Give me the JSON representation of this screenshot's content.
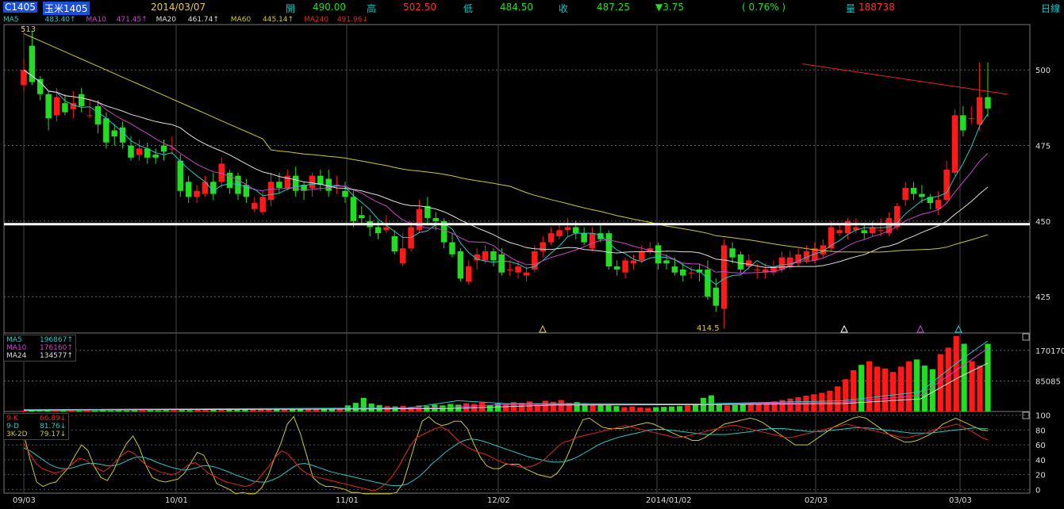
{
  "header": {
    "symbol": "C1405",
    "name": "玉米1405",
    "date": "2014/03/07",
    "open_label": "開",
    "open": "490.00",
    "high_label": "高",
    "high": "502.50",
    "low_label": "低",
    "low": "484.50",
    "close_label": "收",
    "close": "487.25",
    "change": "▼3.75",
    "change_pct": "( 0.76% )",
    "volume_label": "量",
    "volume": "188738",
    "period": "日線"
  },
  "price_legend": {
    "ma5_label": "MA5",
    "ma5": "483.40↑",
    "ma10_label": "MA10",
    "ma10": "471.45↑",
    "ma20_label": "MA20",
    "ma20": "461.74↑",
    "ma60_label": "MA60",
    "ma60": "445.14↑",
    "ma240_label": "MA240",
    "ma240": "491.96↓"
  },
  "volume_legend": {
    "ma5_label": "MA5",
    "ma5": "196867↑",
    "ma10_label": "MA10",
    "ma10": "176160↑",
    "ma24_label": "MA24",
    "ma24": "134577↑"
  },
  "kd_legend": {
    "k_label": "9-K",
    "k": "66.89↓",
    "d_label": "9-D",
    "d": "81.76↓",
    "j_label": "3K-2D",
    "j": "79.17↓"
  },
  "annotations": {
    "high_mark": "513",
    "low_mark": "414.5"
  },
  "colors": {
    "up": "#ff1a1a",
    "down": "#22dd22",
    "ma5": "#22c8c8",
    "ma10": "#cc44cc",
    "ma20": "#dddddd",
    "ma60": "#cccc22",
    "ma240": "#ee2222",
    "grid": "#444444",
    "ref_line": "#ffffff"
  },
  "chart_data": {
    "type": "candlestick",
    "x_tick_labels": [
      "09/03",
      "10/01",
      "11/01",
      "12/02",
      "2014/01/02",
      "02/03",
      "03/03"
    ],
    "price_axis": {
      "ticks": [
        425,
        450,
        475,
        500
      ],
      "range": [
        413,
        515
      ]
    },
    "volume_axis": {
      "ticks": [
        85085,
        170170
      ],
      "range": [
        0,
        210000
      ]
    },
    "kd_axis": {
      "ticks": [
        0,
        20,
        40,
        60,
        80,
        100
      ],
      "range": [
        -5,
        105
      ]
    },
    "reference_price": 449,
    "candles": [
      [
        495,
        500,
        504,
        493
      ],
      [
        508,
        496,
        513,
        495
      ],
      [
        497,
        492,
        498,
        490
      ],
      [
        492,
        484,
        493,
        480
      ],
      [
        485,
        491,
        494,
        483
      ],
      [
        489,
        486,
        492,
        485
      ],
      [
        487,
        489,
        493,
        484
      ],
      [
        492,
        488,
        494,
        486
      ],
      [
        485,
        485,
        490,
        484
      ],
      [
        488,
        482,
        490,
        479
      ],
      [
        484,
        476,
        486,
        474
      ],
      [
        480,
        478,
        482,
        475
      ],
      [
        481,
        476,
        483,
        474
      ],
      [
        475,
        471,
        478,
        470
      ],
      [
        472,
        474,
        477,
        470
      ],
      [
        474,
        471,
        476,
        469
      ],
      [
        472,
        471,
        474,
        469
      ],
      [
        475,
        473,
        477,
        470
      ],
      [
        474,
        474,
        478,
        472
      ],
      [
        470,
        460,
        472,
        458
      ],
      [
        463,
        458,
        465,
        456
      ],
      [
        458,
        460,
        462,
        456
      ],
      [
        459,
        463,
        465,
        458
      ],
      [
        463,
        459,
        466,
        457
      ],
      [
        463,
        469,
        471,
        461
      ],
      [
        466,
        461,
        467,
        459
      ],
      [
        465,
        459,
        466,
        457
      ],
      [
        462,
        458,
        464,
        456
      ],
      [
        454,
        456,
        458,
        453
      ],
      [
        453,
        458,
        460,
        452
      ],
      [
        457,
        463,
        466,
        455
      ],
      [
        463,
        461,
        466,
        459
      ],
      [
        461,
        465,
        467,
        460
      ],
      [
        465,
        460,
        468,
        458
      ],
      [
        462,
        460,
        463,
        457
      ],
      [
        461,
        465,
        466,
        458
      ],
      [
        465,
        462,
        467,
        460
      ],
      [
        464,
        460,
        467,
        458
      ],
      [
        462,
        462,
        465,
        459
      ],
      [
        460,
        458,
        463,
        456
      ],
      [
        458,
        450,
        460,
        448
      ],
      [
        452,
        451,
        455,
        449
      ],
      [
        450,
        448,
        452,
        445
      ],
      [
        448,
        446,
        450,
        444
      ],
      [
        447,
        448,
        452,
        446
      ],
      [
        445,
        440,
        447,
        439
      ],
      [
        436,
        441,
        446,
        435
      ],
      [
        441,
        448,
        450,
        440
      ],
      [
        447,
        454,
        457,
        446
      ],
      [
        455,
        451,
        458,
        449
      ],
      [
        451,
        450,
        453,
        447
      ],
      [
        450,
        443,
        451,
        441
      ],
      [
        443,
        439,
        446,
        438
      ],
      [
        440,
        431,
        441,
        430
      ],
      [
        430,
        435,
        437,
        429
      ],
      [
        437,
        439,
        441,
        434
      ],
      [
        437,
        440,
        442,
        436
      ],
      [
        440,
        437,
        441,
        435
      ],
      [
        439,
        433,
        441,
        432
      ],
      [
        434,
        434,
        437,
        432
      ],
      [
        433,
        435,
        437,
        431
      ],
      [
        432,
        433,
        435,
        430
      ],
      [
        434,
        440,
        442,
        433
      ],
      [
        440,
        443,
        445,
        438
      ],
      [
        443,
        446,
        448,
        442
      ],
      [
        445,
        447,
        449,
        444
      ],
      [
        447,
        448,
        451,
        445
      ],
      [
        448,
        446,
        450,
        444
      ],
      [
        446,
        443,
        448,
        442
      ],
      [
        441,
        446,
        448,
        440
      ],
      [
        446,
        444,
        449,
        443
      ],
      [
        446,
        435,
        447,
        434
      ],
      [
        435,
        434,
        437,
        432
      ],
      [
        433,
        437,
        438,
        431
      ],
      [
        436,
        437,
        439,
        434
      ],
      [
        437,
        440,
        442,
        436
      ],
      [
        440,
        441,
        443,
        439
      ],
      [
        442,
        436,
        443,
        434
      ],
      [
        437,
        436,
        439,
        434
      ],
      [
        435,
        433,
        438,
        432
      ],
      [
        434,
        432,
        436,
        430
      ],
      [
        433,
        433,
        435,
        431
      ],
      [
        434,
        433,
        436,
        430
      ],
      [
        434,
        425,
        437,
        424
      ],
      [
        428,
        422,
        431,
        420
      ],
      [
        421,
        442,
        444,
        414.5
      ],
      [
        441,
        438,
        443,
        436
      ],
      [
        439,
        434,
        440,
        433
      ],
      [
        435,
        437,
        439,
        434
      ],
      [
        434,
        434,
        436,
        431
      ],
      [
        433,
        434,
        436,
        431
      ],
      [
        433,
        435,
        437,
        432
      ],
      [
        434,
        438,
        440,
        433
      ],
      [
        435,
        438,
        440,
        434
      ],
      [
        436,
        439,
        441,
        435
      ],
      [
        437,
        440,
        442,
        436
      ],
      [
        437,
        441,
        443,
        436
      ],
      [
        439,
        442,
        444,
        438
      ],
      [
        441,
        448,
        450,
        440
      ],
      [
        446,
        447,
        449,
        445
      ],
      [
        446,
        450,
        451,
        444
      ],
      [
        447,
        448,
        451,
        446
      ],
      [
        447,
        446,
        449,
        444
      ],
      [
        446,
        448,
        450,
        445
      ],
      [
        447,
        447,
        451,
        445
      ],
      [
        446,
        451,
        453,
        445
      ],
      [
        448,
        455,
        456,
        447
      ],
      [
        457,
        461,
        463,
        455
      ],
      [
        461,
        459,
        463,
        457
      ],
      [
        459,
        458,
        462,
        456
      ],
      [
        458,
        456,
        459,
        454
      ],
      [
        454,
        457,
        460,
        452
      ],
      [
        457,
        467,
        470,
        456
      ],
      [
        466,
        485,
        487,
        465
      ],
      [
        485,
        480,
        488,
        478
      ],
      [
        484,
        484,
        488,
        482
      ],
      [
        482,
        491,
        502.5,
        480
      ],
      [
        491,
        487.25,
        502.5,
        484.5
      ]
    ],
    "price_ma240_endpoints": [
      [
        0.75,
        502
      ],
      [
        0.93,
        491.96
      ]
    ],
    "volume_dates_note": "approximate",
    "volume": [
      2100,
      2300,
      1900,
      2500,
      2000,
      2200,
      2400,
      2100,
      2600,
      2300,
      2800,
      2500,
      3000,
      2700,
      3200,
      2900,
      3400,
      3100,
      3600,
      3300,
      4000,
      3700,
      4500,
      4200,
      5000,
      4700,
      5500,
      5200,
      6000,
      5700,
      6500,
      6200,
      7000,
      6700,
      7500,
      7200,
      8000,
      7700,
      8500,
      8200,
      9000,
      17000,
      24000,
      38000,
      22000,
      18000,
      15000,
      14000,
      16000,
      13000,
      17000,
      15000,
      19000,
      17000,
      21000,
      19000,
      23000,
      21000,
      25000,
      18000,
      22000,
      20000,
      26000,
      24000,
      28000,
      22000,
      30000,
      27000,
      32000,
      24000,
      26000,
      23000,
      21000,
      19000,
      17000,
      15000,
      12000,
      14000,
      11000,
      10000,
      12000,
      13000,
      14000,
      15000,
      17000,
      22000,
      38000,
      45000,
      20000,
      17000,
      18000,
      19000,
      21000,
      23000,
      25000,
      28000,
      32000,
      36000,
      40000,
      44000,
      48000,
      52000,
      58000,
      70000,
      90000,
      115000,
      130000,
      140000,
      125000,
      120000,
      110000,
      125000,
      140000,
      145000,
      128000,
      118000,
      160000,
      178000,
      210000,
      188738,
      140000,
      128000,
      188738
    ],
    "volume_ma_series": [
      {
        "name": "MA5",
        "color": "#22c8c8",
        "points": [
          [
            0,
            5000
          ],
          [
            0.4,
            10000
          ],
          [
            0.45,
            30000
          ],
          [
            0.5,
            22000
          ],
          [
            0.7,
            21000
          ],
          [
            0.85,
            30000
          ],
          [
            0.93,
            55000
          ],
          [
            0.97,
            140000
          ],
          [
            1,
            196867
          ]
        ]
      },
      {
        "name": "MA10",
        "color": "#cc44cc",
        "points": [
          [
            0,
            4000
          ],
          [
            0.42,
            9000
          ],
          [
            0.5,
            20000
          ],
          [
            0.7,
            20000
          ],
          [
            0.85,
            26000
          ],
          [
            0.93,
            45000
          ],
          [
            0.97,
            120000
          ],
          [
            1,
            176160
          ]
        ]
      },
      {
        "name": "MA24",
        "color": "#dddddd",
        "points": [
          [
            0,
            3500
          ],
          [
            0.44,
            8000
          ],
          [
            0.55,
            18000
          ],
          [
            0.7,
            19000
          ],
          [
            0.85,
            22000
          ],
          [
            0.93,
            35000
          ],
          [
            0.97,
            95000
          ],
          [
            1,
            134577
          ]
        ]
      }
    ],
    "kd": {
      "k": [
        62,
        48,
        35,
        28,
        25,
        22,
        24,
        28,
        35,
        42,
        40,
        34,
        28,
        24,
        30,
        38,
        46,
        52,
        48,
        40,
        32,
        28,
        24,
        22,
        20,
        22,
        28,
        34,
        36,
        30,
        22,
        18,
        14,
        10,
        8,
        6,
        4,
        6,
        12,
        22,
        32,
        44,
        52,
        48,
        38,
        28,
        22,
        18,
        16,
        14,
        12,
        10,
        8,
        6,
        4,
        2,
        0,
        -2,
        2,
        8,
        18,
        30,
        45,
        60,
        70,
        74,
        78,
        82,
        84,
        80,
        72,
        64,
        58,
        54,
        50,
        48,
        44,
        40,
        36,
        34,
        32,
        30,
        30,
        32,
        36,
        42,
        50,
        58,
        64,
        66,
        70,
        72,
        74,
        76,
        78,
        80,
        82,
        84,
        86,
        84,
        82,
        80,
        78,
        76,
        74,
        72,
        70,
        70,
        72,
        74,
        76,
        78,
        80,
        82,
        84,
        86,
        86,
        84,
        82,
        80,
        78,
        76,
        74,
        72,
        70,
        70,
        72,
        74,
        76,
        78,
        80,
        82,
        84,
        86,
        88,
        86,
        84,
        82,
        80,
        78,
        76,
        74,
        72,
        70,
        70,
        72,
        74,
        76,
        80,
        82,
        84,
        86,
        88,
        84,
        80,
        75,
        70,
        66.89
      ],
      "d": [
        56,
        52,
        46,
        40,
        34,
        30,
        28,
        28,
        30,
        33,
        35,
        35,
        34,
        32,
        32,
        34,
        38,
        42,
        44,
        43,
        40,
        36,
        33,
        30,
        28,
        26,
        27,
        29,
        32,
        32,
        30,
        27,
        24,
        20,
        17,
        14,
        11,
        10,
        10,
        13,
        17,
        23,
        29,
        34,
        35,
        33,
        30,
        27,
        24,
        22,
        20,
        18,
        16,
        14,
        12,
        10,
        8,
        6,
        5,
        5,
        7,
        12,
        18,
        26,
        35,
        42,
        50,
        56,
        62,
        66,
        68,
        67,
        65,
        62,
        59,
        56,
        53,
        50,
        47,
        44,
        42,
        40,
        38,
        37,
        37,
        38,
        41,
        45,
        50,
        55,
        60,
        64,
        67,
        70,
        72,
        74,
        76,
        78,
        80,
        81,
        81,
        80,
        79,
        78,
        77,
        76,
        75,
        74,
        74,
        74,
        74,
        75,
        76,
        77,
        78,
        80,
        81,
        82,
        82,
        82,
        81,
        80,
        79,
        78,
        78,
        78,
        79,
        80,
        81,
        82,
        83,
        83,
        83,
        82,
        81,
        80,
        79,
        78,
        77,
        76,
        76,
        76,
        76,
        77,
        78,
        79,
        80,
        81,
        82,
        83,
        82,
        81.76
      ],
      "j": [
        74,
        40,
        10,
        4,
        8,
        10,
        20,
        30,
        46,
        60,
        52,
        30,
        16,
        12,
        26,
        46,
        62,
        72,
        56,
        32,
        16,
        12,
        10,
        12,
        14,
        22,
        36,
        50,
        46,
        28,
        8,
        4,
        0,
        -6,
        -4,
        -6,
        -6,
        2,
        18,
        42,
        62,
        88,
        98,
        76,
        46,
        16,
        8,
        4,
        4,
        2,
        0,
        -4,
        -4,
        -6,
        -6,
        -6,
        -6,
        -6,
        -4,
        8,
        36,
        66,
        92,
        98,
        90,
        86,
        88,
        92,
        92,
        82,
        62,
        44,
        32,
        28,
        28,
        34,
        34,
        34,
        28,
        24,
        20,
        18,
        16,
        22,
        34,
        54,
        76,
        94,
        96,
        90,
        84,
        82,
        82,
        82,
        84,
        86,
        88,
        90,
        88,
        84,
        80,
        76,
        72,
        70,
        66,
        66,
        70,
        76,
        82,
        88,
        90,
        92,
        94,
        96,
        94,
        90,
        84,
        78,
        72,
        66,
        60,
        60,
        60,
        66,
        72,
        78,
        84,
        88,
        92,
        96,
        98,
        96,
        90,
        84,
        78,
        72,
        68,
        64,
        64,
        66,
        70,
        74,
        80,
        88,
        92,
        96,
        92,
        88,
        84,
        80,
        79.17
      ]
    }
  }
}
